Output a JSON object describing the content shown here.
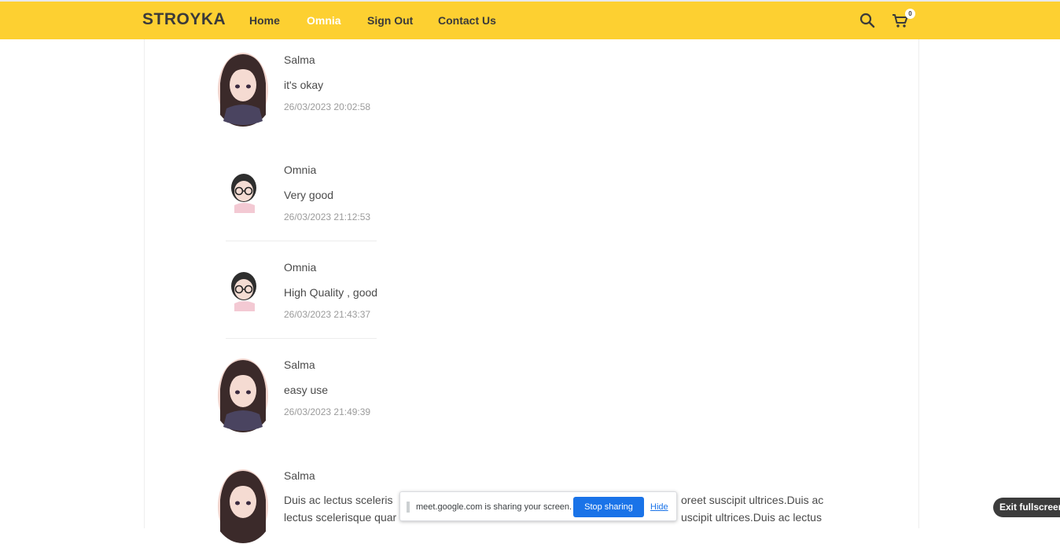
{
  "navbar": {
    "logo": "STROYKA",
    "links": [
      {
        "label": "Home",
        "active": false
      },
      {
        "label": "Omnia",
        "active": true
      },
      {
        "label": "Sign Out",
        "active": false
      },
      {
        "label": "Contact Us",
        "active": false
      }
    ],
    "cart_count": "0",
    "icons": [
      "search-icon",
      "cart-icon"
    ]
  },
  "reviews": [
    {
      "name": "Salma",
      "text": "it's okay",
      "date": "26/03/2023 20:02:58",
      "avatar": "girl-avatar"
    },
    {
      "name": "Omnia",
      "text": "Very good",
      "date": "26/03/2023 21:12:53",
      "avatar": "glasses-avatar"
    },
    {
      "name": "Omnia",
      "text": "High Quality , good",
      "date": "26/03/2023 21:43:37",
      "avatar": "glasses-avatar"
    },
    {
      "name": "Salma",
      "text": "easy use",
      "date": "26/03/2023 21:49:39",
      "avatar": "girl-avatar"
    },
    {
      "name": "Salma",
      "text_line1": "Duis ac lectus sceleris",
      "text_line1_end": "oreet suscipit ultrices.Duis ac",
      "text_line2": "lectus scelerisque quar",
      "text_line2_end": "uscipit ultrices.Duis ac lectus",
      "avatar": "girl-avatar"
    }
  ],
  "screen_share": {
    "message": "meet.google.com is sharing your screen.",
    "stop_label": "Stop sharing",
    "hide_label": "Hide"
  },
  "exit_fullscreen_label": "Exit fullscreen",
  "colors": {
    "accent": "#fdd031",
    "share_button": "#1a73e8"
  }
}
